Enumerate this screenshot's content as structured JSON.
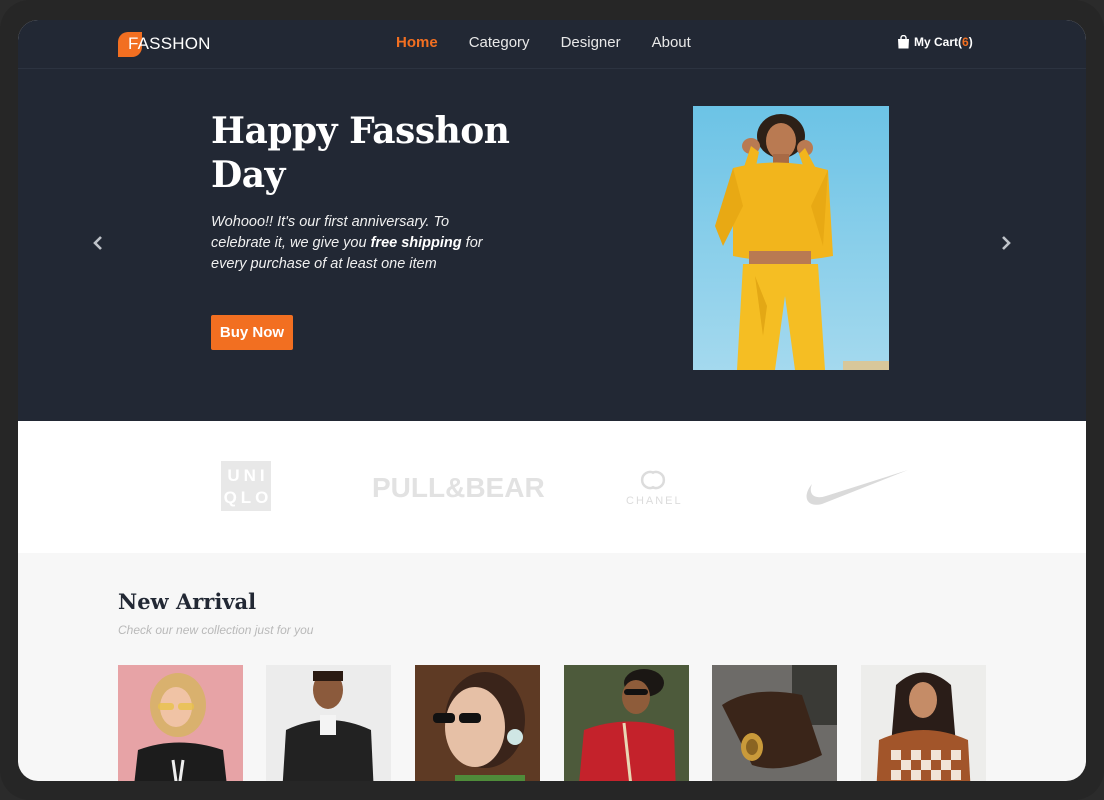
{
  "brand": {
    "logo_text": "FASSHON"
  },
  "nav": {
    "items": [
      "Home",
      "Category",
      "Designer",
      "About"
    ],
    "active": "Home"
  },
  "cart": {
    "label": "My Cart",
    "open": "(",
    "count": "6",
    "close": ")"
  },
  "hero": {
    "title": "Happy Fasshon Day",
    "text_before": "Wohooo!! It's our first anniversary. To celebrate it, we give you ",
    "text_bold": "free shipping",
    "text_after": " for every purchase of at least one item",
    "button": "Buy Now"
  },
  "brands": {
    "uniqlo_line1": "UNI",
    "uniqlo_line2": "QLO",
    "pullbear": "PULL&BEAR",
    "chanel": "CHANEL"
  },
  "arrivals": {
    "title": "New Arrival",
    "subtitle": "Check our new collection just for you"
  },
  "colors": {
    "accent": "#f26f21",
    "dark": "#222834",
    "light_bg": "#f7f7f7"
  },
  "icons": [
    "chevron-left-icon",
    "chevron-right-icon",
    "shopping-bag-icon"
  ]
}
